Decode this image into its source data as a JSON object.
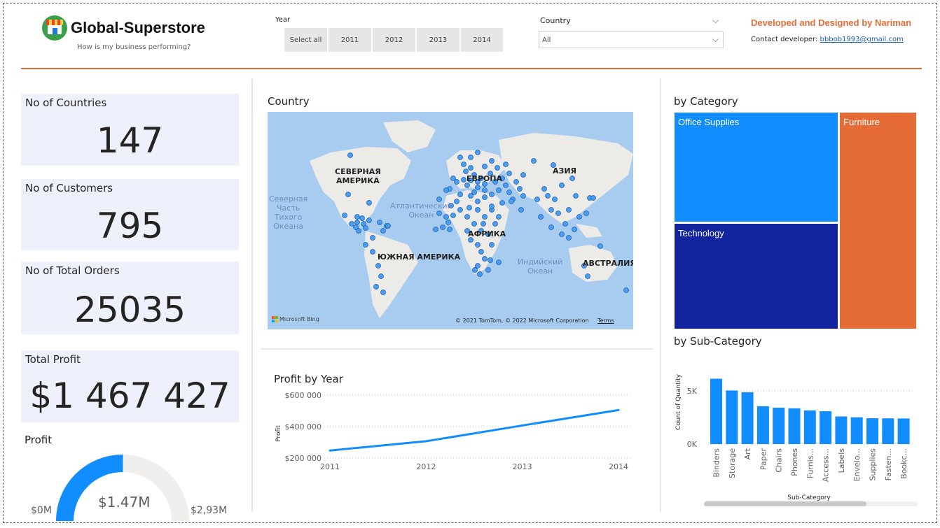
{
  "header": {
    "title": "Global-Superstore",
    "subtitle": "How is my business performing?",
    "year_label": "Year",
    "year_options": [
      "Select all",
      "2011",
      "2012",
      "2013",
      "2014"
    ],
    "country_label": "Country",
    "country_value": "All",
    "developer_title": "Developed and Designed by Nariman",
    "contact_label": "Contact developer: ",
    "contact_email": "bbbob1993@gmail.com"
  },
  "kpis": {
    "countries": {
      "label": "No of Countries",
      "value": "147"
    },
    "customers": {
      "label": "No of Customers",
      "value": "795"
    },
    "orders": {
      "label": "No of Total Orders",
      "value": "25035"
    },
    "profit": {
      "label": "Total Profit",
      "value": "$1 467 427"
    }
  },
  "gauge": {
    "title": "Profit",
    "min_label": "$0M",
    "max_label": "$2,93M",
    "value_label": "$1.47M",
    "value": 1.47,
    "max": 2.93,
    "fill_color": "#118dff",
    "track_color": "#f0efee"
  },
  "map": {
    "title": "Country",
    "continents": {
      "north_america": "СЕВЕРНАЯ\nАМЕРИКА",
      "europe": "ЕВРОПА",
      "asia": "АЗИЯ",
      "africa": "АФРИКА",
      "south_america": "ЮЖНАЯ АМЕРИКА",
      "australia": "АВСТРАЛИЯ"
    },
    "oceans": {
      "pacific": "Северная\nЧасть\nТихого\nОкеана",
      "atlantic": "Атлантический\nОкеан",
      "indian": "Индийский\nОкеан"
    },
    "attribution": "Microsoft Bing",
    "copyright": "© 2021 TomTom, © 2022 Microsoft Corporation",
    "terms": "Terms",
    "colors": {
      "water": "#a8ccf0",
      "land": "#ecebe7",
      "point": "#4a9df5"
    }
  },
  "category": {
    "title": "by Category",
    "items": [
      {
        "name": "Office Supplies",
        "color": "#118dff"
      },
      {
        "name": "Furniture",
        "color": "#e66c37"
      },
      {
        "name": "Technology",
        "color": "#12239e"
      }
    ]
  },
  "chart_data": [
    {
      "type": "line",
      "title": "Profit by Year",
      "xlabel": "",
      "ylabel": "Profit",
      "x": [
        "2011",
        "2012",
        "2013",
        "2014"
      ],
      "series": [
        {
          "values": [
            248000,
            307000,
            407000,
            505000
          ]
        }
      ],
      "ylim": [
        200000,
        600000
      ],
      "yticks": [
        "$200 000",
        "$400 000",
        "$600 000"
      ],
      "color": "#118dff",
      "grid": true
    },
    {
      "type": "bar",
      "title": "by Sub-Category",
      "xlabel": "Sub-Category",
      "ylabel": "Count of Quantity",
      "categories": [
        "Binders",
        "Storage",
        "Art",
        "Paper",
        "Chairs",
        "Phones",
        "Furnis...",
        "Access...",
        "Labels",
        "Envelo...",
        "Supplies",
        "Fasten...",
        "Bookc..."
      ],
      "values": [
        6150,
        5040,
        4880,
        3560,
        3420,
        3360,
        3170,
        3090,
        2600,
        2520,
        2430,
        2420,
        2410
      ],
      "yticks": [
        "0K",
        "5K"
      ],
      "color": "#118dff",
      "grid": true
    }
  ]
}
